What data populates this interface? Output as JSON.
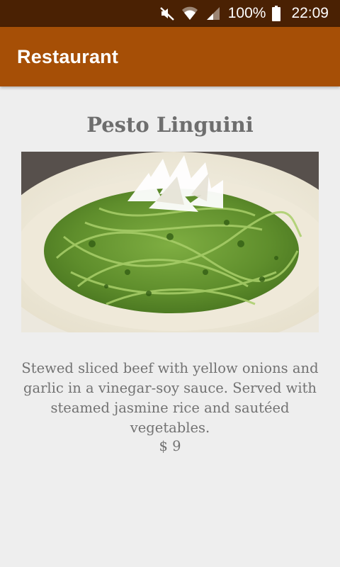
{
  "status_bar": {
    "battery_percent": "100%",
    "time": "22:09",
    "icons": [
      "mute-icon",
      "wifi-icon",
      "signal-icon",
      "battery-icon"
    ]
  },
  "app_bar": {
    "title": "Restaurant",
    "color": "#a64f06"
  },
  "dish": {
    "name": "Pesto Linguini",
    "description": "Stewed sliced beef with yellow onions and garlic in a vinegar-soy sauce. Served with steamed jasmine rice and sautéed vegetables.",
    "price": "$ 9"
  },
  "colors": {
    "status_bar": "#4a2103",
    "background": "#eeeeee",
    "text": "#727272"
  }
}
